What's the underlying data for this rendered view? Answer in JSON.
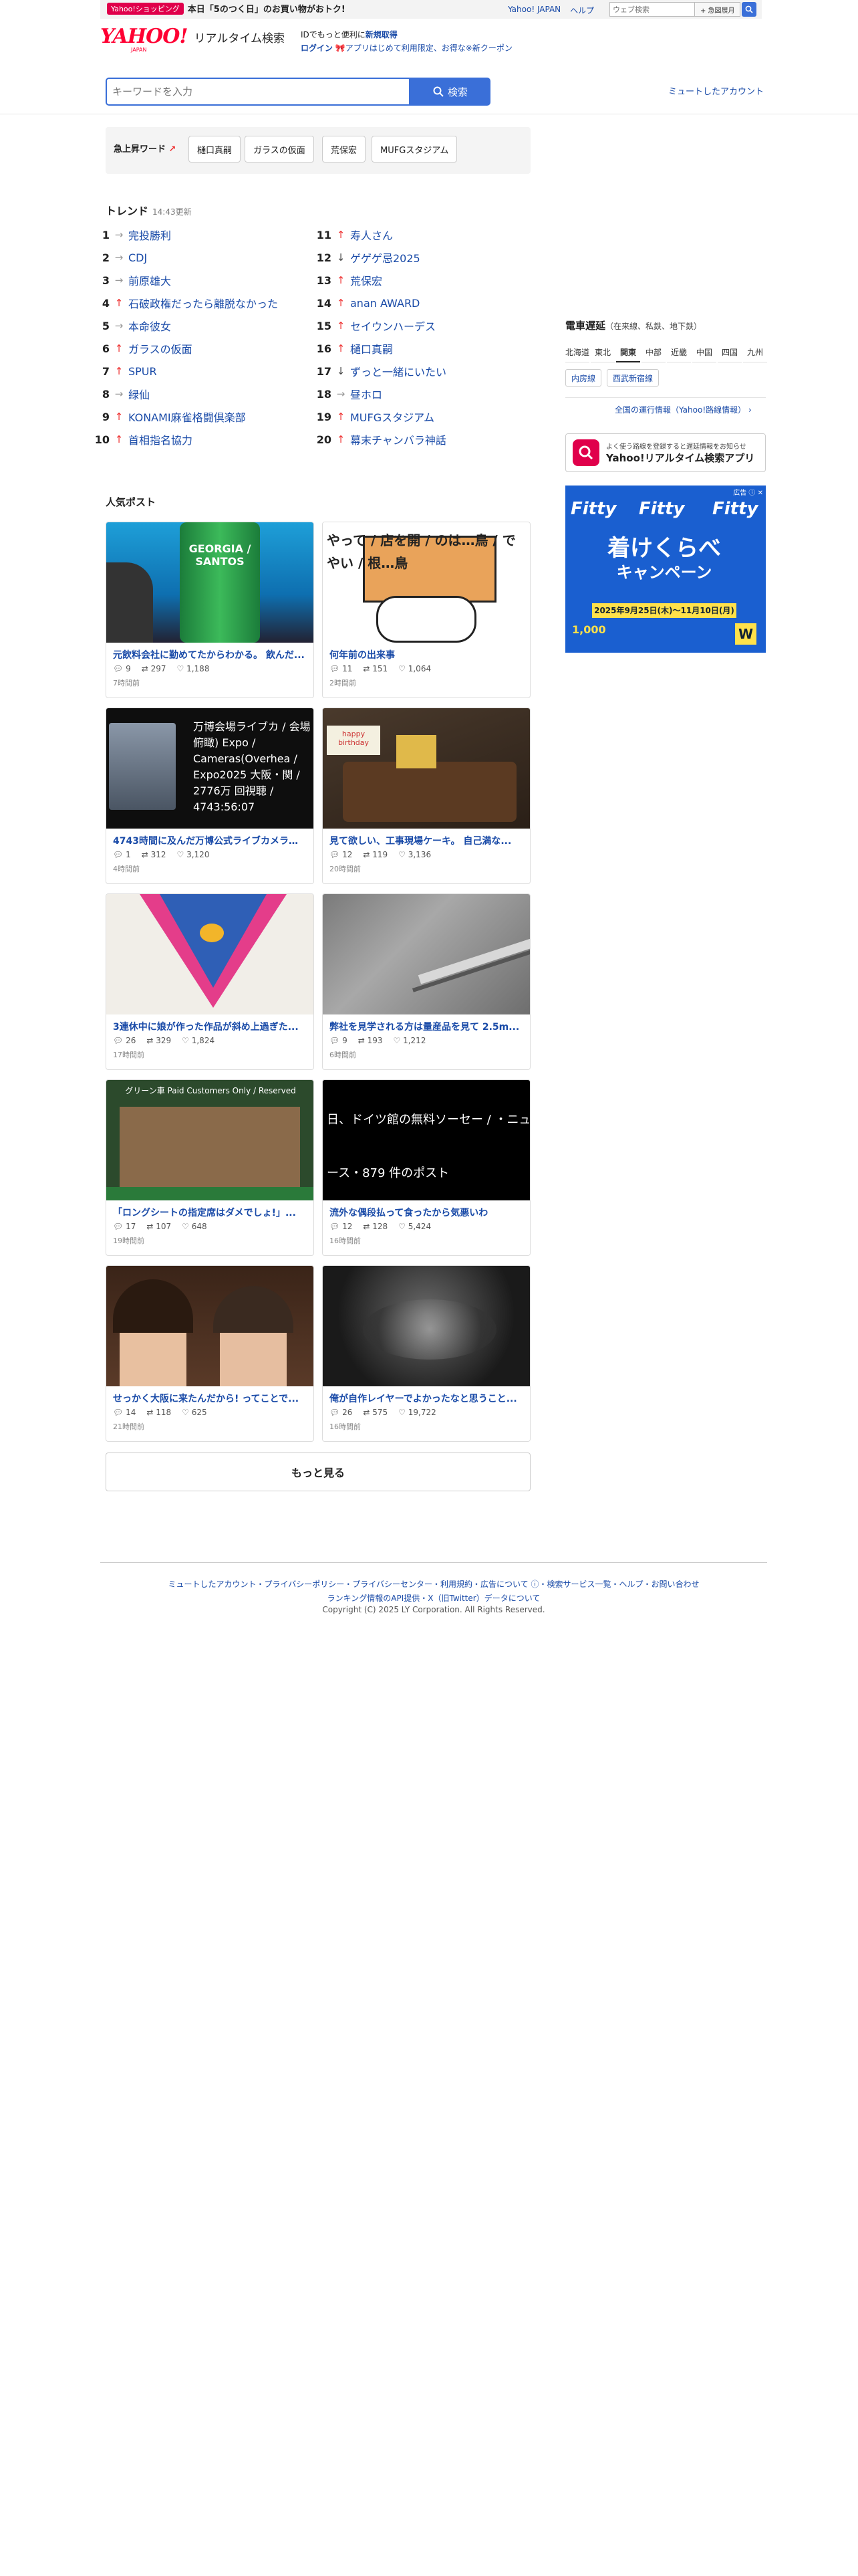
{
  "topbar": {
    "promo_badge": "Yahoo!ショッピング",
    "promo_text": "本日「5のつく日」のお買い物がおトク!",
    "links": [
      "Yahoo! JAPAN",
      "ヘルプ"
    ],
    "web_search_placeholder": "ウェブ検索",
    "web_search_button": "+ 急図展月"
  },
  "header": {
    "logo": "YAHOO!",
    "logo_sub": "JAPAN",
    "service_name": "リアルタイム検索",
    "info_line1_prefix": "IDでもっと便利に",
    "info_line1_link": "新規取得",
    "info_line2_login": "ログイン",
    "info_line2_text": "アプリはじめて利用限定、お得な※新クーポン"
  },
  "search": {
    "placeholder": "キーワードを入力",
    "button_label": "検索",
    "muted_accounts": "ミュートしたアカウント"
  },
  "surge": {
    "label": "急上昇ワード",
    "words": [
      "樋口真嗣",
      "ガラスの仮面",
      "荒保宏",
      "MUFGスタジアム"
    ]
  },
  "trends": {
    "title": "トレンド",
    "updated": "14:43更新",
    "items": [
      {
        "rank": "1",
        "dir": "flat",
        "word": "完投勝利"
      },
      {
        "rank": "2",
        "dir": "flat",
        "word": "CDJ"
      },
      {
        "rank": "3",
        "dir": "flat",
        "word": "前原雄大"
      },
      {
        "rank": "4",
        "dir": "up",
        "word": "石破政権だったら離脱なかった"
      },
      {
        "rank": "5",
        "dir": "flat",
        "word": "本命彼女"
      },
      {
        "rank": "6",
        "dir": "up",
        "word": "ガラスの仮面"
      },
      {
        "rank": "7",
        "dir": "up",
        "word": "SPUR"
      },
      {
        "rank": "8",
        "dir": "flat",
        "word": "緑仙"
      },
      {
        "rank": "9",
        "dir": "up",
        "word": "KONAMI麻雀格闘倶楽部"
      },
      {
        "rank": "10",
        "dir": "up",
        "word": "首相指名協力"
      },
      {
        "rank": "11",
        "dir": "up",
        "word": "寿人さん"
      },
      {
        "rank": "12",
        "dir": "down",
        "word": "ゲゲゲ忌2025"
      },
      {
        "rank": "13",
        "dir": "up",
        "word": "荒保宏"
      },
      {
        "rank": "14",
        "dir": "up",
        "word": "anan AWARD"
      },
      {
        "rank": "15",
        "dir": "up",
        "word": "セイウンハーデス"
      },
      {
        "rank": "16",
        "dir": "up",
        "word": "樋口真嗣"
      },
      {
        "rank": "17",
        "dir": "down",
        "word": "ずっと一緒にいたい"
      },
      {
        "rank": "18",
        "dir": "flat",
        "word": "昼ホロ"
      },
      {
        "rank": "19",
        "dir": "up",
        "word": "MUFGスタジアム"
      },
      {
        "rank": "20",
        "dir": "up",
        "word": "幕末チャンバラ神話"
      }
    ]
  },
  "posts": {
    "title": "人気ポスト",
    "items": [
      {
        "title": "元飲料会社に勤めてたからわかる。 飲んだ...",
        "replies": "9",
        "reposts": "297",
        "likes": "1,188",
        "time": "7時間前",
        "img_text": "GEORGIA / SANTOS"
      },
      {
        "title": "何年前の出来事",
        "replies": "11",
        "reposts": "151",
        "likes": "1,064",
        "time": "2時間前",
        "img_text": "やって / 店を開 / のは…鳥 / でやい / 根…鳥"
      },
      {
        "title": "4743時間に及んだ万博公式ライブカメラが...",
        "replies": "1",
        "reposts": "312",
        "likes": "3,120",
        "time": "4時間前",
        "img_text": "万博会場ライブカ / 会場俯瞰) Expo / Cameras(Overhea / Expo2025 大阪・関 / 2776万 回視聴 / 4743:56:07"
      },
      {
        "title": "見て欲しい、工事現場ケーキ。 自己満な...",
        "replies": "12",
        "reposts": "119",
        "likes": "3,136",
        "time": "20時間前",
        "img_text": "happy birthday"
      },
      {
        "title": "3連休中に娘が作った作品が斜め上過ぎた...",
        "replies": "26",
        "reposts": "329",
        "likes": "1,824",
        "time": "17時間前",
        "img_text": ""
      },
      {
        "title": "弊社を見学される方は量産品を見て 2.5m...",
        "replies": "9",
        "reposts": "193",
        "likes": "1,212",
        "time": "6時間前",
        "img_text": ""
      },
      {
        "title": "「ロングシートの指定席はダメでしょ!」...",
        "replies": "17",
        "reposts": "107",
        "likes": "648",
        "time": "19時間前",
        "img_text": "グリーン車 Paid Customers Only / Reserved"
      },
      {
        "title": "流外な偶段払って食ったから気悪いわ",
        "replies": "12",
        "reposts": "128",
        "likes": "5,424",
        "time": "16時間前",
        "img_text": "日、ドイツ館の無料ソーセー / ・ニュース・879 件のポスト"
      },
      {
        "title": "せっかく大阪に来たんだから! ってことで...",
        "replies": "14",
        "reposts": "118",
        "likes": "625",
        "time": "21時間前",
        "img_text": ""
      },
      {
        "title": "俺が自作レイヤーでよかったなと思うこと...",
        "replies": "26",
        "reposts": "575",
        "likes": "19,722",
        "time": "16時間前",
        "img_text": ""
      }
    ],
    "more_label": "もっと見る"
  },
  "sidebar": {
    "train_title": "電車遅延",
    "train_sub": "（在来線、私鉄、地下鉄）",
    "regions": [
      "北海道",
      "東北",
      "関東",
      "中部",
      "近畿",
      "中国",
      "四国",
      "九州"
    ],
    "selected_region": "関東",
    "lines": [
      "内房線",
      "西武新宿線"
    ],
    "train_link": "全国の運行情報（Yahoo!路線情報）",
    "app_small": "よく使う路線を登録すると遅延情報をお知らせ",
    "app_name": "Yahoo!リアルタイム検索アプリ",
    "ad_label": "広告",
    "ad_brand": "Fitty",
    "ad_title": "着けくらべ",
    "ad_campaign": "キャンペーン",
    "ad_date": "2025年9月25日(木)～11月10日(月)",
    "ad_points": "1,000",
    "ad_w": "W"
  },
  "footer": {
    "links1": "ミュートしたアカウント・プライバシーポリシー・プライバシーセンター・利用規約・広告について ⓘ・検索サービス一覧・ヘルプ・お問い合わせ",
    "links2": "ランキング情報のAPI提供・X（旧Twitter）データについて",
    "copyright": "Copyright (C) 2025 LY Corporation. All Rights Reserved."
  }
}
